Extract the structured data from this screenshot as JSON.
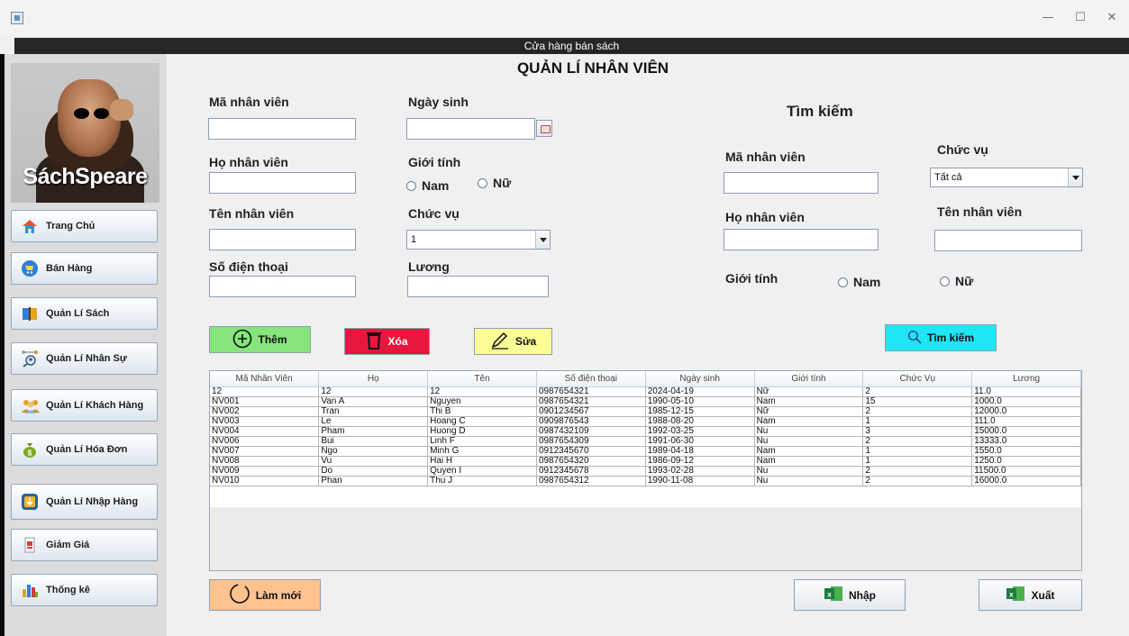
{
  "window": {
    "header_title": "Cửa hàng bán sách",
    "controls": {
      "minimize": "—",
      "maximize": "☐",
      "close": "✕"
    }
  },
  "sidebar": {
    "logo_text": "SáchSpeare",
    "items": [
      {
        "label": "Trang Chủ",
        "icon": "home-icon"
      },
      {
        "label": "Bán Hàng",
        "icon": "cart-icon"
      },
      {
        "label": "Quản Lí Sách",
        "icon": "book-icon"
      },
      {
        "label": "Quản Lí Nhân Sự",
        "icon": "staff-search-icon"
      },
      {
        "label": "Quản Lí Khách Hàng",
        "icon": "customers-icon"
      },
      {
        "label": "Quản Lí Hóa Đơn",
        "icon": "money-bag-icon"
      },
      {
        "label": "Quản Lí Nhập Hàng",
        "icon": "import-icon"
      },
      {
        "label": "Giảm Giá",
        "icon": "discount-icon"
      },
      {
        "label": "Thống kê",
        "icon": "stats-icon"
      }
    ]
  },
  "main": {
    "title": "QUẢN LÍ NHÂN VIÊN",
    "form": {
      "ma_nv_label": "Mã nhân viên",
      "ngay_sinh_label": "Ngày sinh",
      "ho_nv_label": "Họ nhân viên",
      "gioi_tinh_label": "Giới tính",
      "nam_label": "Nam",
      "nu_label": "Nữ",
      "ten_nv_label": "Tên nhân viên",
      "chuc_vu_label": "Chức vụ",
      "chuc_vu_value": "1",
      "sdt_label": "Số điện thoại",
      "luong_label": "Lương"
    },
    "search": {
      "title": "Tìm kiếm",
      "ma_nv_label": "Mã nhân viên",
      "chuc_vu_label": "Chức vụ",
      "chuc_vu_value": "Tất cả",
      "ho_nv_label": "Họ nhân viên",
      "ten_nv_label": "Tên nhân viên",
      "gioi_tinh_label": "Giới tính",
      "nam_label": "Nam",
      "nu_label": "Nữ"
    },
    "buttons": {
      "them": "Thêm",
      "xoa": "Xóa",
      "sua": "Sửa",
      "tim_kiem": "Tìm kiếm",
      "lam_moi": "Làm mới",
      "nhap": "Nhập",
      "xuat": "Xuất"
    },
    "table": {
      "columns": [
        "Mã Nhân Viên",
        "Họ",
        "Tên",
        "Số điện thoại",
        "Ngày sinh",
        "Giới tính",
        "Chức Vụ",
        "Lương"
      ],
      "rows": [
        [
          "12",
          "12",
          "12",
          "0987654321",
          "2024-04-19",
          "Nữ",
          "2",
          "11.0"
        ],
        [
          "NV001",
          "Van A",
          "Nguyen",
          "0987654321",
          "1990-05-10",
          "Nam",
          "15",
          "1000.0"
        ],
        [
          "NV002",
          "Tran",
          "Thi B",
          "0901234567",
          "1985-12-15",
          "Nữ",
          "2",
          "12000.0"
        ],
        [
          "NV003",
          "Le",
          "Hoang C",
          "0909876543",
          "1988-08-20",
          "Nam",
          "1",
          "111.0"
        ],
        [
          "NV004",
          "Pham",
          "Huong D",
          "0987432109",
          "1992-03-25",
          "Nu",
          "3",
          "15000.0"
        ],
        [
          "NV006",
          "Bui",
          "Linh F",
          "0987654309",
          "1991-06-30",
          "Nu",
          "2",
          "13333.0"
        ],
        [
          "NV007",
          "Ngo",
          "Minh G",
          "0912345670",
          "1989-04-18",
          "Nam",
          "1",
          "1550.0"
        ],
        [
          "NV008",
          "Vu",
          "Hai H",
          "0987654320",
          "1986-09-12",
          "Nam",
          "1",
          "1250.0"
        ],
        [
          "NV009",
          "Do",
          "Quyen I",
          "0912345678",
          "1993-02-28",
          "Nu",
          "2",
          "11500.0"
        ],
        [
          "NV010",
          "Phan",
          "Thu J",
          "0987654312",
          "1990-11-08",
          "Nu",
          "2",
          "16000.0"
        ]
      ]
    }
  },
  "colors": {
    "them_bg": "#86e57d",
    "xoa_bg": "#e8163e",
    "sua_bg": "#fdfd98",
    "tim_kiem_bg": "#1fe6f2",
    "lam_moi_bg": "#fdc28e",
    "header_bg": "#262626"
  }
}
